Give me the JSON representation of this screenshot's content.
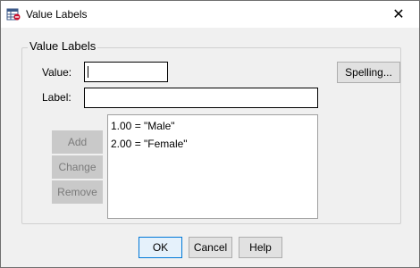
{
  "window": {
    "title": "Value Labels",
    "close_glyph": "✕"
  },
  "group": {
    "legend": "Value Labels"
  },
  "value_field": {
    "label": "Value:",
    "value": ""
  },
  "label_field": {
    "label": "Label:",
    "value": ""
  },
  "spelling_button": "Spelling...",
  "side_buttons": {
    "add": "Add",
    "change": "Change",
    "remove": "Remove"
  },
  "list_items": [
    "1.00 = \"Male\"",
    "2.00 = \"Female\""
  ],
  "footer": {
    "ok": "OK",
    "cancel": "Cancel",
    "help": "Help"
  }
}
